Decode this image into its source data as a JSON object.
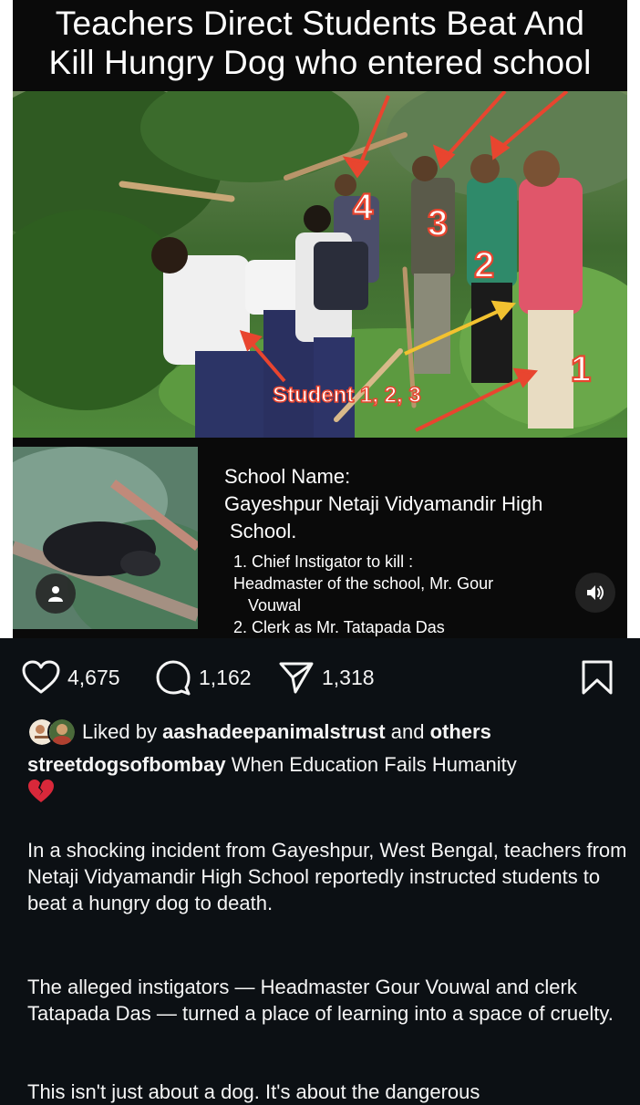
{
  "post": {
    "headline_line1": "Teachers Direct Students Beat And",
    "headline_line2": "Kill Hungry Dog who entered school",
    "photo_labels": {
      "n1": "1",
      "n2": "2",
      "n3": "3",
      "n4": "4",
      "students": "Student 1, 2, 3"
    },
    "info": {
      "label": "School Name:",
      "name_line1": "Gayeshpur Netaji Vidyamandir High",
      "name_line2": "School.",
      "item1_line1": "1. Chief Instigator to kill :",
      "item1_line2": "Headmaster of the school, Mr. Gour",
      "item1_line3": "Vouwal",
      "item2": "2. Clerk as Mr. Tatapada Das"
    }
  },
  "actions": {
    "likes": "4,675",
    "comments": "1,162",
    "shares": "1,318"
  },
  "liked_by": {
    "prefix": "Liked by",
    "user": "aashadeepanimalstrust",
    "middle": "and",
    "suffix": "others"
  },
  "caption": {
    "username": "streetdogsofbombay",
    "text": "When Education Fails Humanity",
    "emoji": "💔",
    "para1": "In a shocking incident from Gayeshpur, West Bengal, teachers from Netaji Vidyamandir High School reportedly instructed students to beat a hungry dog to death.",
    "para2": "The alleged instigators — Headmaster Gour Vouwal and clerk Tatapada Das — turned a place of learning into a space of cruelty.",
    "para3": "This isn't just about a dog. It's about the dangerous"
  },
  "colors": {
    "background": "#0c1014",
    "text": "#f5f5f5",
    "annotation_red": "#e8452f",
    "annotation_yellow": "#f2c230"
  },
  "icons": [
    "heart-icon",
    "comment-icon",
    "share-icon",
    "bookmark-icon",
    "user-tag-icon",
    "speaker-icon"
  ]
}
